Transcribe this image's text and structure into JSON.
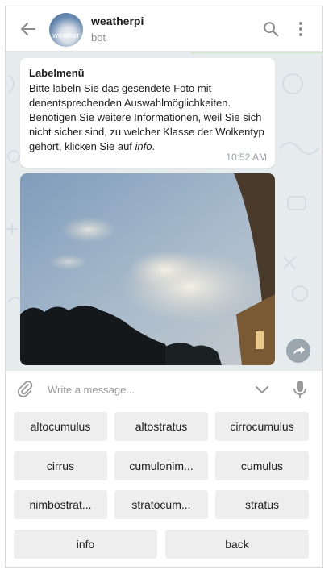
{
  "header": {
    "title": "weatherpi",
    "subtitle": "bot",
    "avatar_text": "weather"
  },
  "chat": {
    "message": {
      "title": "Labelmenü",
      "body_main": "Bitte labeln Sie das gesendete Foto mit denentsprechenden Auswahlmöglichkeiten. Benötigen Sie weitere Informationen, weil Sie sich nicht sicher sind, zu welcher Klasse der Wolkentyp gehört, klicken Sie auf ",
      "body_em": "info",
      "body_end": ".",
      "time": "10:52 AM"
    }
  },
  "composer": {
    "placeholder": "Write a message..."
  },
  "keyboard": {
    "rows": [
      [
        "altocumulus",
        "altostratus",
        "cirrocumulus"
      ],
      [
        "cirrus",
        "cumulonim...",
        "cumulus"
      ],
      [
        "nimbostrat...",
        "stratocum...",
        "stratus"
      ],
      [
        "info",
        "back"
      ]
    ]
  },
  "colors": {
    "chat_background": "#e6ebee",
    "button_background": "#eeeeee",
    "time_text": "#9aa3ab",
    "placeholder_text": "#999999"
  },
  "icons": [
    "back-arrow-icon",
    "search-icon",
    "more-vert-icon",
    "share-icon",
    "attach-icon",
    "chevron-down-icon",
    "mic-icon"
  ]
}
